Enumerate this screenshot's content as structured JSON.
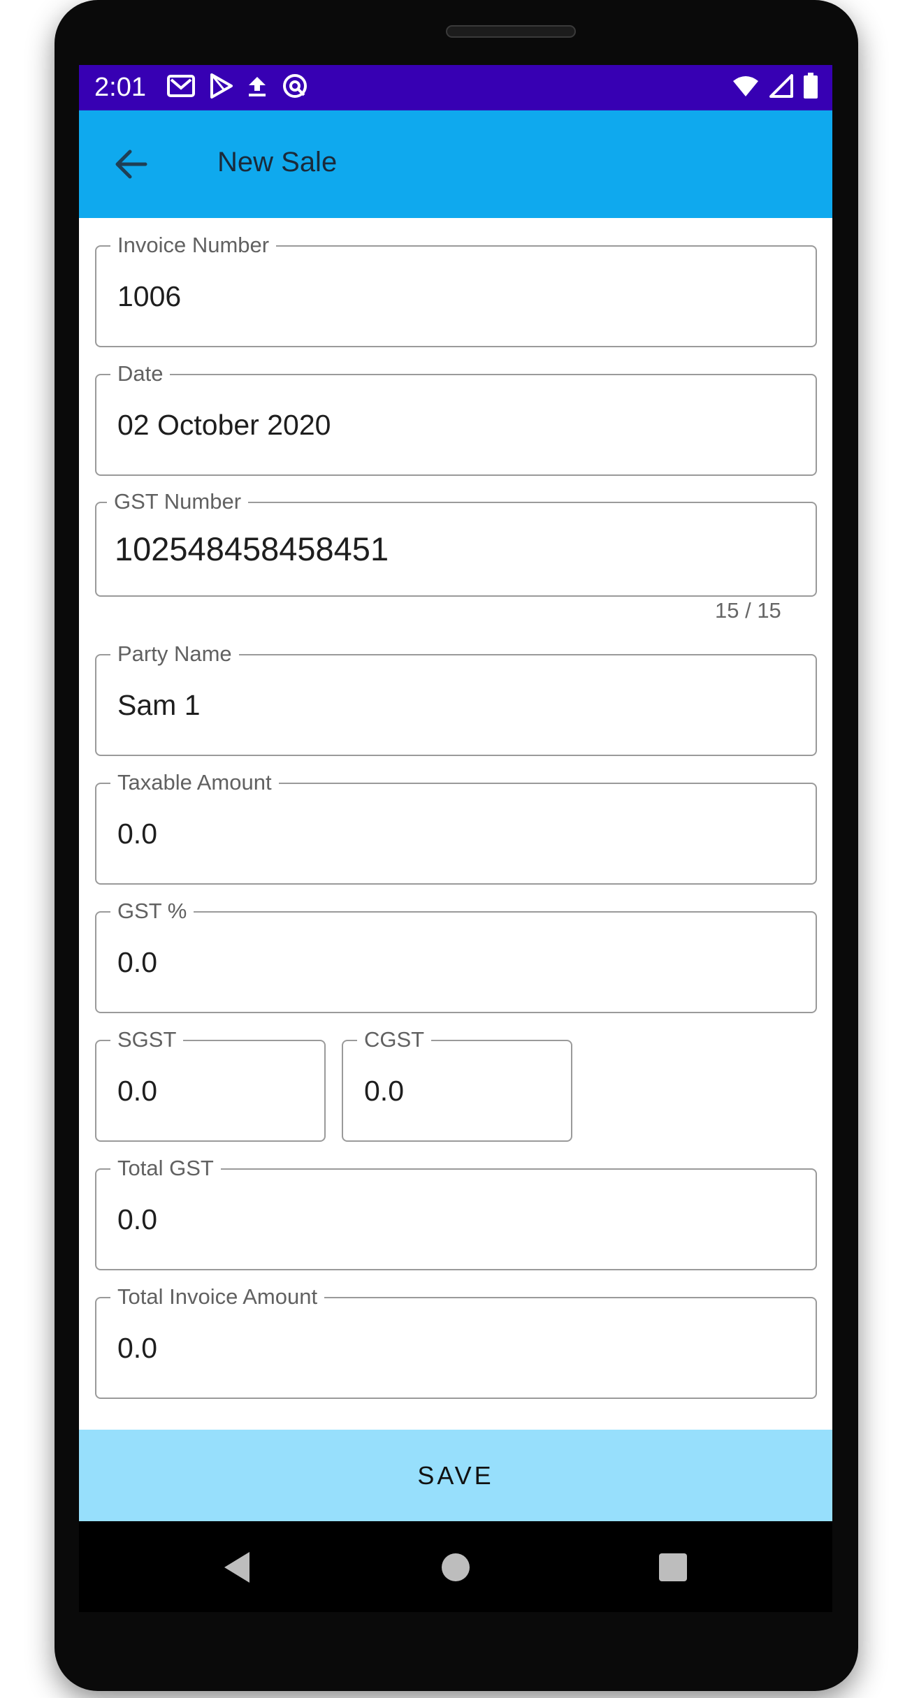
{
  "status_bar": {
    "time": "2:01",
    "left_icons": [
      "gmail-icon",
      "play-store-icon",
      "upload-icon",
      "sync-icon"
    ],
    "right_icons": [
      "wifi-icon",
      "cell-signal-icon",
      "battery-icon"
    ]
  },
  "app_bar": {
    "title": "New Sale",
    "back_icon": "arrow-left-icon",
    "color": "#0fa9ee"
  },
  "form": {
    "invoice_number": {
      "label": "Invoice Number",
      "value": "1006"
    },
    "date": {
      "label": "Date",
      "value": "02 October 2020"
    },
    "gst_number": {
      "label": "GST Number",
      "value": "102548458458451",
      "counter": "15 / 15"
    },
    "party_name": {
      "label": "Party Name",
      "value": "Sam 1"
    },
    "taxable_amount": {
      "label": "Taxable Amount",
      "value": "0.0"
    },
    "gst_percent": {
      "label": "GST %",
      "value": "0.0"
    },
    "sgst": {
      "label": "SGST",
      "value": "0.0"
    },
    "cgst": {
      "label": "CGST",
      "value": "0.0"
    },
    "total_gst": {
      "label": "Total GST",
      "value": "0.0"
    },
    "total_invoice_amount": {
      "label": "Total Invoice Amount",
      "value": "0.0"
    }
  },
  "save_button": {
    "label": "SAVE",
    "color": "#97dffc"
  },
  "colors": {
    "status_bar": "#3700b3",
    "field_border": "#9a9a9a"
  },
  "nav_bar": {
    "icons": [
      "back-triangle-icon",
      "home-circle-icon",
      "recents-square-icon"
    ]
  }
}
